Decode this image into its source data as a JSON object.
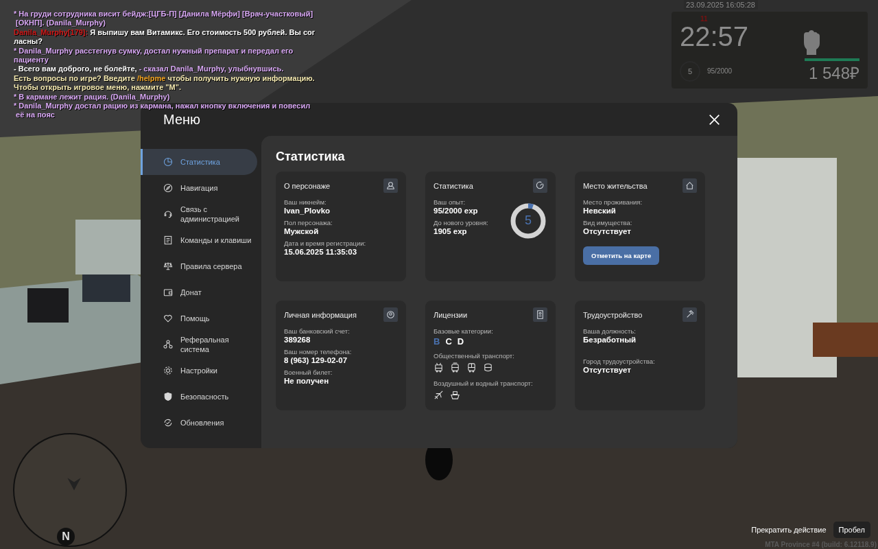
{
  "chat": [
    {
      "segments": [
        {
          "text": "* На груди сотрудника висит бейдж:[ЦГБ-П] [Данила Мёрфи] [Врач-участковый]",
          "color": "#d9a8f5"
        }
      ]
    },
    {
      "segments": [
        {
          "text": " [ОКНП]. (Danila_Murphy)",
          "color": "#d9a8f5"
        }
      ]
    },
    {
      "segments": [
        {
          "text": "Danila_Murphy[179]:",
          "color": "#d01818"
        },
        {
          "text": " Я выпишу вам Витамикс. Его стоимость 500 рублей. Вы сог",
          "color": "#ffffff"
        }
      ]
    },
    {
      "segments": [
        {
          "text": "ласны?",
          "color": "#ffffff"
        }
      ]
    },
    {
      "segments": [
        {
          "text": "* Danila_Murphy расстегнув сумку, достал нужный препарат и передал его",
          "color": "#d9a8f5"
        }
      ]
    },
    {
      "segments": [
        {
          "text": "пациенту",
          "color": "#d9a8f5"
        }
      ]
    },
    {
      "segments": [
        {
          "text": "- Всего вам доброго, не болейте, ",
          "color": "#ffffff"
        },
        {
          "text": "- сказал Danila_Murphy, улыбнувшись.",
          "color": "#d9a8f5"
        }
      ]
    },
    {
      "segments": [
        {
          "text": "Есть вопросы по игре? Введите ",
          "color": "#f4e9b0"
        },
        {
          "text": "/helpme",
          "color": "#f5a623"
        },
        {
          "text": " чтобы получить нужную информацию.",
          "color": "#f4e9b0"
        }
      ]
    },
    {
      "segments": [
        {
          "text": "Чтобы открыть игровое меню, нажмите \"M\".",
          "color": "#f4e9b0"
        }
      ]
    },
    {
      "segments": [
        {
          "text": "* В кармане лежит рация. (Danila_Murphy)",
          "color": "#d9a8f5"
        }
      ]
    },
    {
      "segments": [
        {
          "text": "* Danila_Murphy достал рацию из кармана, нажал кнопку включения и повесил",
          "color": "#d9a8f5"
        }
      ]
    },
    {
      "segments": [
        {
          "text": " её на пояс",
          "color": "#d9a8f5"
        }
      ]
    }
  ],
  "hud": {
    "date": "23.09.2025 16:05:28",
    "wanted": "11",
    "time": "22:57",
    "level": "5",
    "exp": "95/2000",
    "health": {
      "level": 1
    },
    "money": "1 548₽"
  },
  "menu": {
    "title": "Меню",
    "sidebar": [
      {
        "label": "Статистика",
        "selected": true
      },
      {
        "label": "Навигация",
        "selected": false
      },
      {
        "label": "Связь с администрацией",
        "selected": false
      },
      {
        "label": "Команды и клавиши",
        "selected": false
      },
      {
        "label": "Правила сервера",
        "selected": false
      },
      {
        "label": "Донат",
        "selected": false
      },
      {
        "label": "Помощь",
        "selected": false
      },
      {
        "label": "Реферальная система",
        "selected": false
      },
      {
        "label": "Настройки",
        "selected": false
      },
      {
        "label": "Безопасность",
        "selected": false
      },
      {
        "label": "Обновления",
        "selected": false
      }
    ],
    "heading": "Статистика",
    "cards": [
      {
        "kind": "info",
        "title": "О персонаже",
        "fields": [
          {
            "label": "Ваш никнейм:",
            "value": "Ivan_Plovko"
          },
          {
            "label": "Пол персонажа:",
            "value": "Мужской"
          },
          {
            "label": "Дата и время регистрации:",
            "value": "15.06.2025 11:35:03"
          }
        ]
      },
      {
        "kind": "stats",
        "title": "Статистика",
        "fields": [
          {
            "label": "Ваш опыт:",
            "value": "95/2000 exp"
          },
          {
            "label": "До нового уровня:",
            "value": "1905 exp"
          }
        ],
        "ring": {
          "text": "5",
          "level": 0.05
        }
      },
      {
        "kind": "info",
        "title": "Место жительства",
        "fields": [
          {
            "label": "Место проживания:",
            "value": "Невский"
          },
          {
            "label": "Вид имущества:",
            "value": "Отсутствует"
          }
        ],
        "button": "Отметить на карте"
      },
      {
        "kind": "info",
        "title": "Личная информация",
        "fields": [
          {
            "label": "Ваш банковский счет:",
            "value": "389268"
          },
          {
            "label": "Ваш номер телефона:",
            "value": "8 (963) 129-02-07"
          },
          {
            "label": "Военный билет:",
            "value": "Не получен"
          }
        ]
      },
      {
        "kind": "licenses",
        "title": "Лицензии",
        "categories_label": "Базовые категории:",
        "categories": [
          {
            "text": "B",
            "active": true
          },
          {
            "text": "C",
            "active": false
          },
          {
            "text": "D",
            "active": false
          }
        ],
        "public_label": "Общественный транспорт:",
        "air_label": "Воздушный и водный транспорт:"
      },
      {
        "kind": "info",
        "title": "Трудоустройство",
        "fields": [
          {
            "label": "Ваша должность:",
            "value": "Безработный"
          },
          {
            "label": "Город трудоустройства:",
            "value": "Отсутствует"
          }
        ],
        "spaced": true
      }
    ]
  },
  "minimap": {
    "north": "N"
  },
  "hint": {
    "action": "Прекратить действие",
    "key": "Пробел"
  },
  "version": "MTA Province #4 (build: 6.12118.9)"
}
